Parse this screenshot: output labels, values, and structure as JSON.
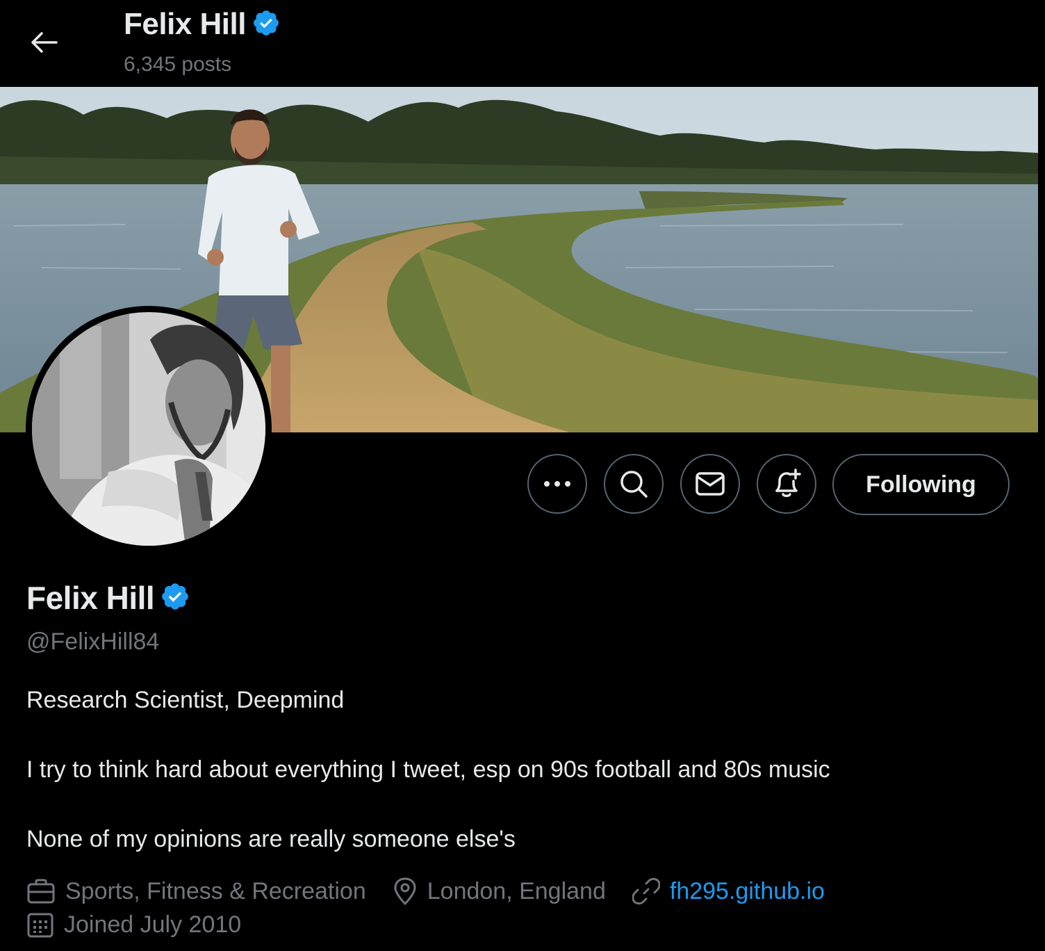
{
  "header": {
    "name": "Felix Hill",
    "posts": "6,345 posts"
  },
  "actions": {
    "more_icon": "more-icon",
    "search_icon": "search-icon",
    "message_icon": "mail-icon",
    "notify_icon": "bell-plus-icon",
    "following_label": "Following"
  },
  "profile": {
    "name": "Felix Hill",
    "handle": "@FelixHill84",
    "bio": [
      "Research Scientist, Deepmind",
      "I try to think hard about everything I tweet, esp on 90s football and 80s music",
      "None of my opinions are really someone else's"
    ],
    "category": "Sports, Fitness & Recreation",
    "location": "London, England",
    "website": "fh295.github.io",
    "joined": "Joined July 2010"
  },
  "colors": {
    "accent": "#1d9bf0",
    "background": "#000000",
    "text_primary": "#e7e9ea",
    "text_secondary": "#71767b",
    "border": "#536471"
  }
}
